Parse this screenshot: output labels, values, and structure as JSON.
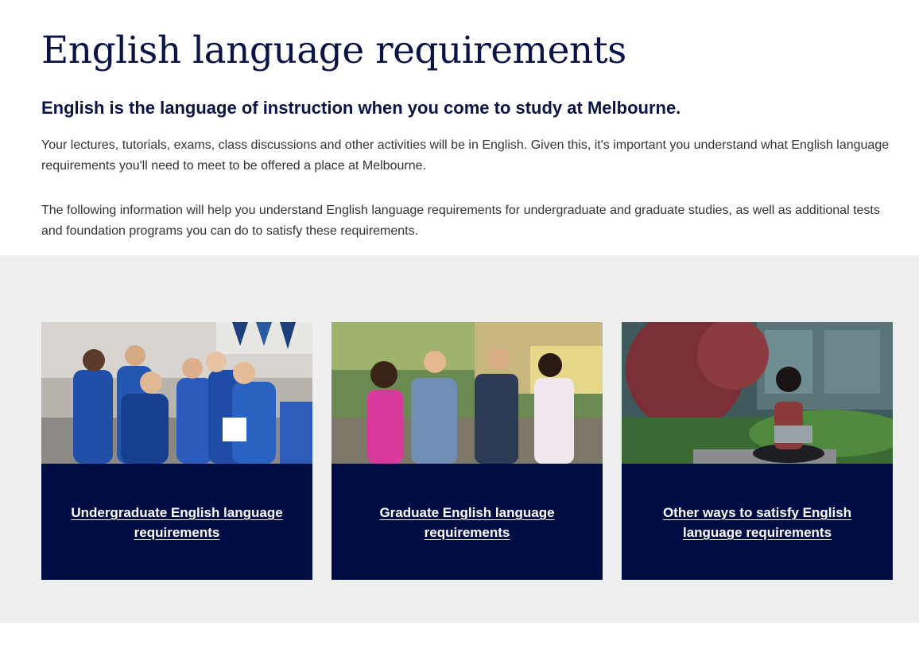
{
  "page": {
    "title": "English language requirements",
    "lead": "English is the language of instruction when you come to study at Melbourne.",
    "paragraphs": [
      "Your lectures, tutorials, exams, class discussions and other activities will be in English. Given this, it's important you understand what English language requirements you'll need to meet to be offered a place at Melbourne.",
      "The following information will help you understand English language requirements for undergraduate and graduate studies, as well as additional tests and foundation programs you can do to satisfy these requirements."
    ]
  },
  "cards": [
    {
      "label": "Undergraduate English language requirements",
      "image": "students-group-photo"
    },
    {
      "label": "Graduate English language requirements",
      "image": "students-talking-photo"
    },
    {
      "label": "Other ways to satisfy English language requirements",
      "image": "student-laptop-photo"
    }
  ],
  "colors": {
    "navy": "#000d45",
    "title": "#0a1446",
    "band": "#efefef"
  }
}
